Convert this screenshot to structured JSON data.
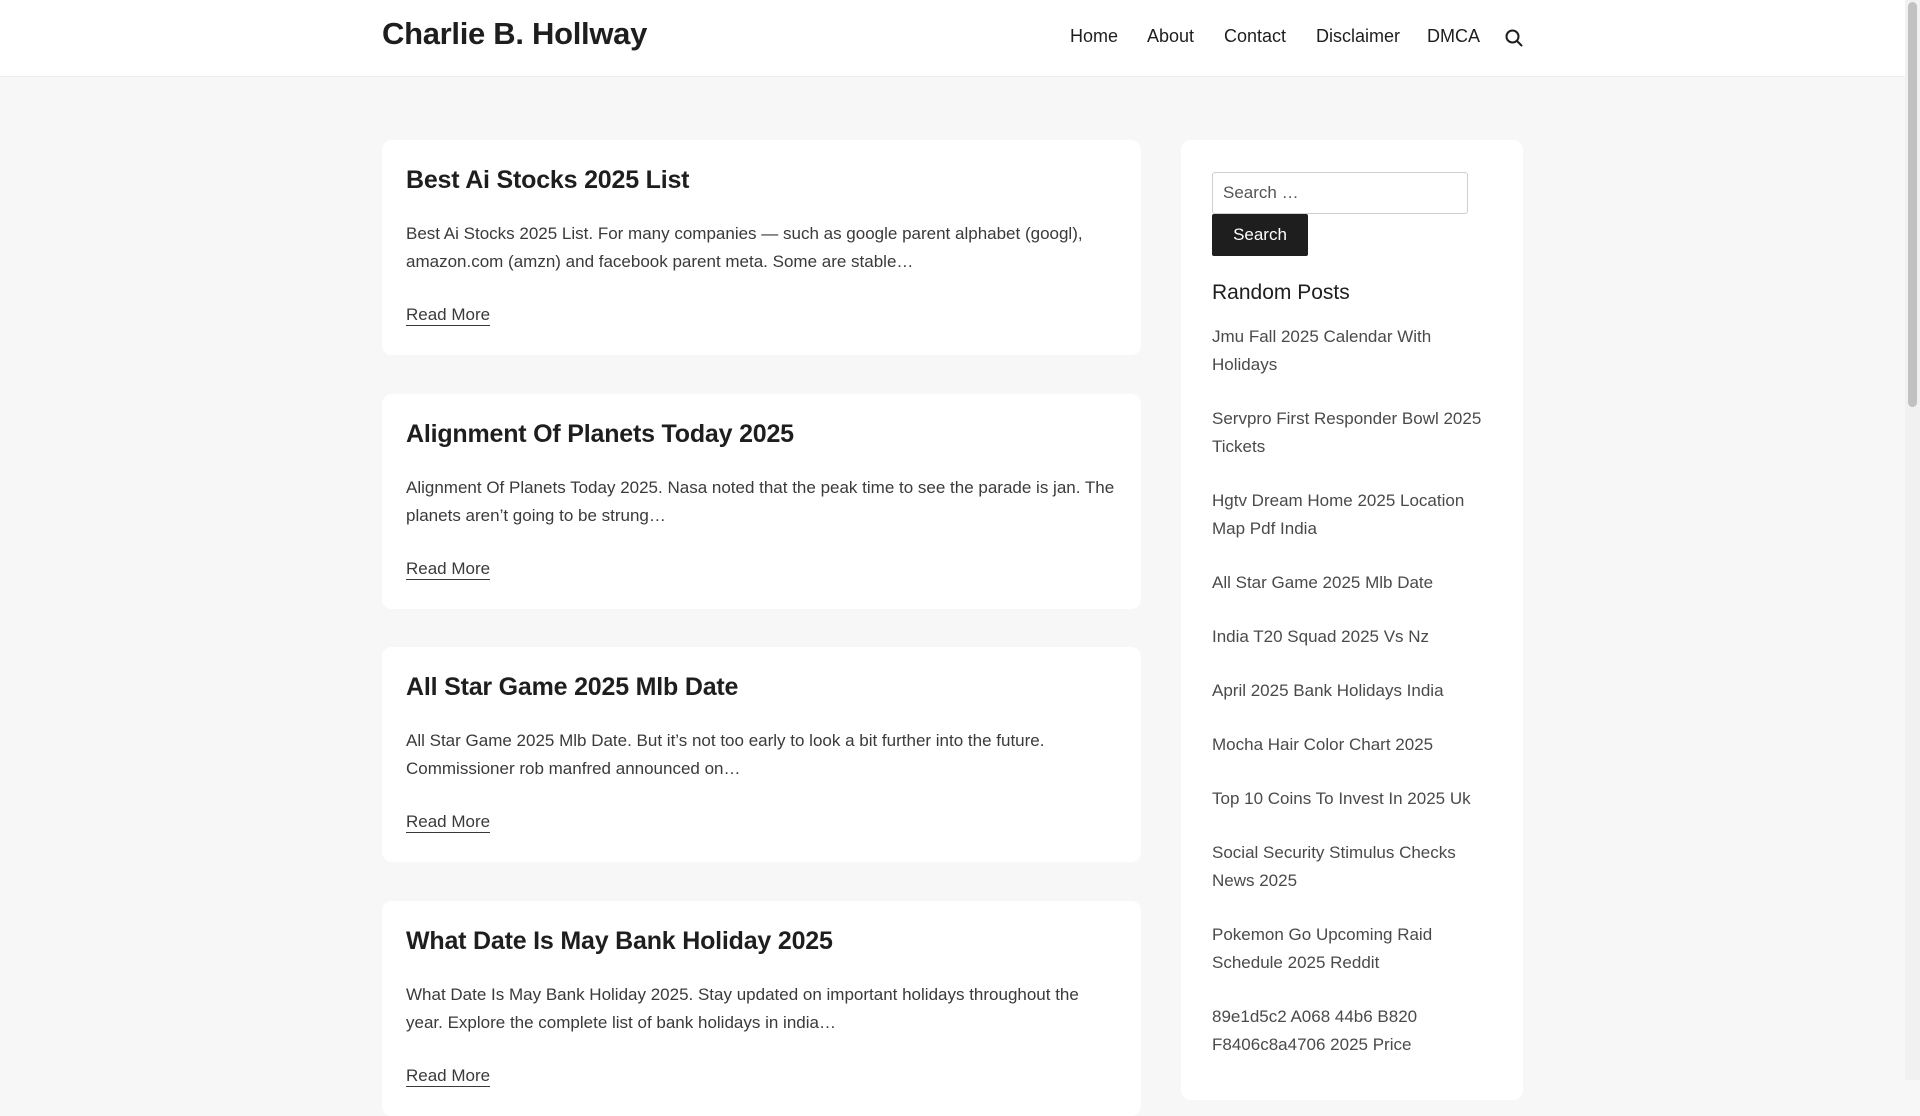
{
  "site": {
    "title": "Charlie B. Hollway"
  },
  "nav": {
    "items": [
      {
        "label": "Home"
      },
      {
        "label": "About"
      },
      {
        "label": "Contact"
      },
      {
        "label": "Disclaimer"
      },
      {
        "label": "DMCA"
      }
    ]
  },
  "posts": [
    {
      "title": "Best Ai Stocks 2025 List",
      "excerpt": "Best Ai Stocks 2025 List. For many companies — such as google parent alphabet (googl), amazon.com (amzn) and facebook parent meta. Some are stable…",
      "read_more": "Read More"
    },
    {
      "title": "Alignment Of Planets Today 2025",
      "excerpt": "Alignment Of Planets Today 2025. Nasa noted that the peak time to see the parade is jan. The planets aren’t going to be strung…",
      "read_more": "Read More"
    },
    {
      "title": "All Star Game 2025 Mlb Date",
      "excerpt": "All Star Game 2025 Mlb Date. But it’s not too early to look a bit further into the future. Commissioner rob manfred announced on…",
      "read_more": "Read More"
    },
    {
      "title": "What Date Is May Bank Holiday 2025",
      "excerpt": "What Date Is May Bank Holiday 2025. Stay updated on important holidays throughout the year. Explore the complete list of bank holidays in india…",
      "read_more": "Read More"
    }
  ],
  "sidebar": {
    "search": {
      "placeholder": "Search …",
      "button_label": "Search"
    },
    "random_posts_title": "Random Posts",
    "random_posts": [
      "Jmu Fall 2025 Calendar With Holidays",
      "Servpro First Responder Bowl 2025 Tickets",
      "Hgtv Dream Home 2025 Location Map Pdf India",
      "All Star Game 2025 Mlb Date",
      "India T20 Squad 2025 Vs Nz",
      "April 2025 Bank Holidays India",
      "Mocha Hair Color Chart 2025",
      "Top 10 Coins To Invest In 2025 Uk",
      "Social Security Stimulus Checks News 2025",
      "Pokemon Go Upcoming Raid Schedule 2025 Reddit",
      "89e1d5c2 A068 44b6 B820 F8406c8a4706 2025 Price"
    ]
  },
  "icons": {
    "search_toggle": "search-icon"
  },
  "colors": {
    "background": "#f7f7f7",
    "card": "#ffffff",
    "button": "#1e1e1e"
  }
}
